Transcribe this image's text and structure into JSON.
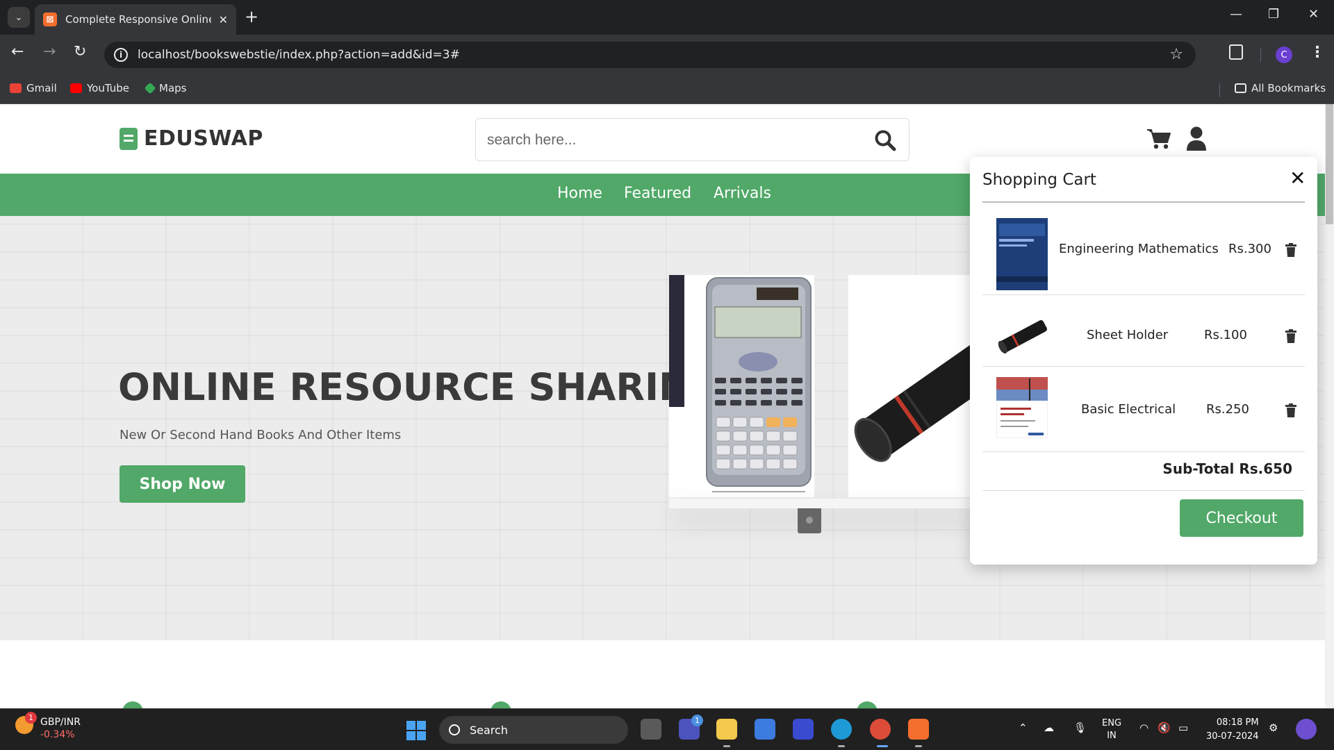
{
  "browser": {
    "tab_title": "Complete Responsive Online Bo",
    "tab_favicon_letter": "⊠",
    "url": "localhost/bookswebstie/index.php?action=add&id=3#",
    "profile_initial": "C",
    "bookmarks": [
      {
        "label": "Gmail",
        "icon": "gmail-icon"
      },
      {
        "label": "YouTube",
        "icon": "youtube-icon"
      },
      {
        "label": "Maps",
        "icon": "maps-icon"
      }
    ],
    "all_bookmarks": "All Bookmarks"
  },
  "site": {
    "logo": "EDUSWAP",
    "search_placeholder": "search here...",
    "nav": [
      "Home",
      "Featured",
      "Arrivals"
    ],
    "brand_color": "#51a868"
  },
  "hero": {
    "title": "ONLINE RESOURCE SHARING",
    "subtitle": "New Or Second Hand Books And Other Items",
    "button": "Shop Now"
  },
  "cart": {
    "title": "Shopping Cart",
    "items": [
      {
        "name": "Engineering Mathematics",
        "price": "Rs.300"
      },
      {
        "name": "Sheet Holder",
        "price": "Rs.100"
      },
      {
        "name": "Basic Electrical",
        "price": "Rs.250"
      }
    ],
    "subtotal": "Sub-Total Rs.650",
    "checkout": "Checkout"
  },
  "taskbar": {
    "widget_badge": "1",
    "widget_pair": "GBP/INR",
    "widget_change": "-0.34%",
    "search_label": "Search",
    "teams_badge": "1",
    "lang_line1": "ENG",
    "lang_line2": "IN",
    "time": "08:18 PM",
    "date": "30-07-2024"
  }
}
